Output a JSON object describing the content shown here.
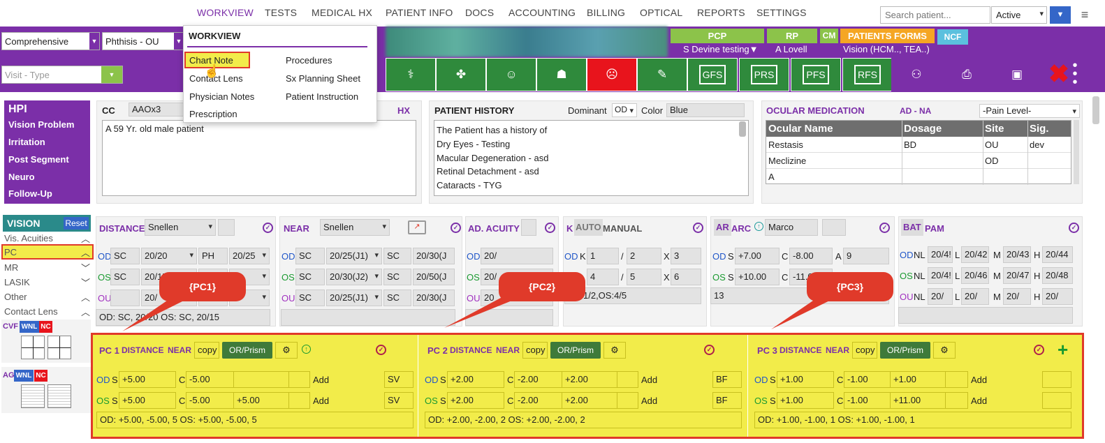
{
  "nav": {
    "items": [
      "WORKVIEW",
      "TESTS",
      "MEDICAL HX",
      "PATIENT INFO",
      "DOCS",
      "ACCOUNTING",
      "BILLING",
      "OPTICAL",
      "REPORTS",
      "SETTINGS"
    ],
    "search_placeholder": "Search patient...",
    "status_value": "Active"
  },
  "header": {
    "visit_template": "Comprehensive",
    "diagnosis": "Phthisis - OU",
    "visit_type": "Visit - Type"
  },
  "providers": {
    "pcp_label": "PCP",
    "pcp_value": "S Devine testing▼",
    "rp_label": "RP",
    "rp_value": "A Lovell",
    "cm_label": "CM",
    "forms_label": "PATIENTS FORMS",
    "forms_value": "Vision (HCM.., TEA..)",
    "ncf_label": "NCF"
  },
  "toolbar": {
    "gfs": "GFS",
    "prs": "PRS",
    "pfs": "PFS",
    "rfs": "RFS"
  },
  "menu": {
    "title": "WORKVIEW",
    "col1": [
      "Chart Note",
      "Contact Lens",
      "Physician Notes",
      "Prescription"
    ],
    "col2": [
      "Procedures",
      "Sx Planning Sheet",
      "Patient Instruction"
    ]
  },
  "hpi": {
    "title": "HPI",
    "items": [
      "Vision Problem",
      "Irritation",
      "Post Segment",
      "Neuro",
      "Follow-Up"
    ]
  },
  "cc": {
    "label": "CC",
    "value": "AAOx3",
    "hx_label": "HX",
    "text": "A 59 Yr. old male patient"
  },
  "history": {
    "title": "PATIENT HISTORY",
    "dominant_label": "Dominant",
    "dominant_value": "OD",
    "color_label": "Color",
    "color_value": "Blue",
    "lines": [
      "The Patient has a history of",
      "Dry Eyes - Testing",
      "Macular Degeneration - asd",
      "Retinal Detachment - asd",
      "Cataracts - TYG"
    ]
  },
  "meds": {
    "title": "OCULAR MEDICATION",
    "ad_na": "AD - NA",
    "pain_level": "-Pain Level-",
    "headers": [
      "Ocular Name",
      "Dosage",
      "Site",
      "Sig."
    ],
    "rows": [
      [
        "Restasis",
        "BD",
        "OU",
        "dev"
      ],
      [
        "Meclizine",
        "",
        "OD",
        ""
      ],
      [
        "A",
        "",
        "",
        ""
      ]
    ]
  },
  "vision_side": {
    "title": "VISION",
    "reset": "Reset",
    "items": [
      "Vis. Acuities",
      "PC",
      "MR",
      "LASIK",
      "Other",
      "Contact Lens"
    ],
    "cvf": "CVF",
    "wnl": "WNL",
    "nc": "NC",
    "ag": "AG"
  },
  "distance": {
    "label": "DISTANCE",
    "chart": "Snellen",
    "od": [
      "SC",
      "20/20",
      "PH",
      "20/25"
    ],
    "os": [
      "SC",
      "20/15"
    ],
    "ou": [
      "",
      "20/"
    ],
    "summary": "OD: SC, 20/20 OS: SC, 20/15"
  },
  "near": {
    "label": "NEAR",
    "chart": "Snellen",
    "od": [
      "SC",
      "20/25(J1)",
      "SC",
      "20/30(J"
    ],
    "os": [
      "SC",
      "20/30(J2)",
      "SC",
      "20/50(J"
    ],
    "ou": [
      "SC",
      "20/25(J1)",
      "SC",
      "20/30(J"
    ]
  },
  "adacuity": {
    "label": "AD. ACUITY",
    "od": "20/",
    "os": "20/",
    "ou": "20"
  },
  "kread": {
    "k": "K",
    "auto": "AUTO",
    "manual": "MANUAL",
    "od": [
      "1",
      "2",
      "3"
    ],
    "os": [
      "4",
      "5",
      "6"
    ],
    "summary": "1/2,OS:4/5"
  },
  "ar": {
    "ar": "AR",
    "arc": "ARC",
    "name": "Marco",
    "od": [
      "+7.00",
      "-8.00",
      "9"
    ],
    "os": [
      "+10.00",
      "-11.00"
    ],
    "summary": "13"
  },
  "bat": {
    "bat": "BAT",
    "pam": "PAM",
    "od": [
      "20/4!",
      "20/42",
      "20/43",
      "20/44"
    ],
    "os": [
      "20/4!",
      "20/46",
      "20/47",
      "20/48"
    ],
    "ou": [
      "20/",
      "20/",
      "20/",
      "20/"
    ]
  },
  "callouts": [
    "{PC1}",
    "{PC2}",
    "{PC3}"
  ],
  "pc": [
    {
      "title": "PC 1",
      "dist": "DISTANCE",
      "near": "NEAR",
      "copy": "copy",
      "prism": "OR/Prism",
      "od": [
        "+5.00",
        "-5.00",
        "5",
        "",
        "SV"
      ],
      "os": [
        "+5.00",
        "-5.00",
        "5",
        "+5.00",
        "SV"
      ],
      "summary": "OD: +5.00, -5.00, 5 OS: +5.00, -5.00, 5"
    },
    {
      "title": "PC 2",
      "dist": "DISTANCE",
      "near": "NEAR",
      "copy": "copy",
      "prism": "OR/Prism",
      "od": [
        "+2.00",
        "-2.00",
        "2",
        "+2.00",
        "BF"
      ],
      "os": [
        "+2.00",
        "-2.00",
        "2",
        "+2.00",
        "BF"
      ],
      "summary": "OD: +2.00, -2.00, 2 OS: +2.00, -2.00, 2"
    },
    {
      "title": "PC 3",
      "dist": "DISTANCE",
      "near": "NEAR",
      "copy": "copy",
      "prism": "OR/Prism",
      "od": [
        "+1.00",
        "-1.00",
        "1",
        "+1.00",
        ""
      ],
      "os": [
        "+1.00",
        "-1.00",
        "1",
        "+11.00",
        ""
      ],
      "summary": "OD: +1.00, -1.00, 1 OS: +1.00, -1.00, 1"
    }
  ],
  "labels": {
    "od": "OD",
    "os": "OS",
    "ou": "OU",
    "s": "S",
    "c": "C",
    "a": "A",
    "add": "Add",
    "x": "X",
    "slash": "/",
    "nl": "NL",
    "l": "L",
    "m": "M",
    "h": "H"
  }
}
